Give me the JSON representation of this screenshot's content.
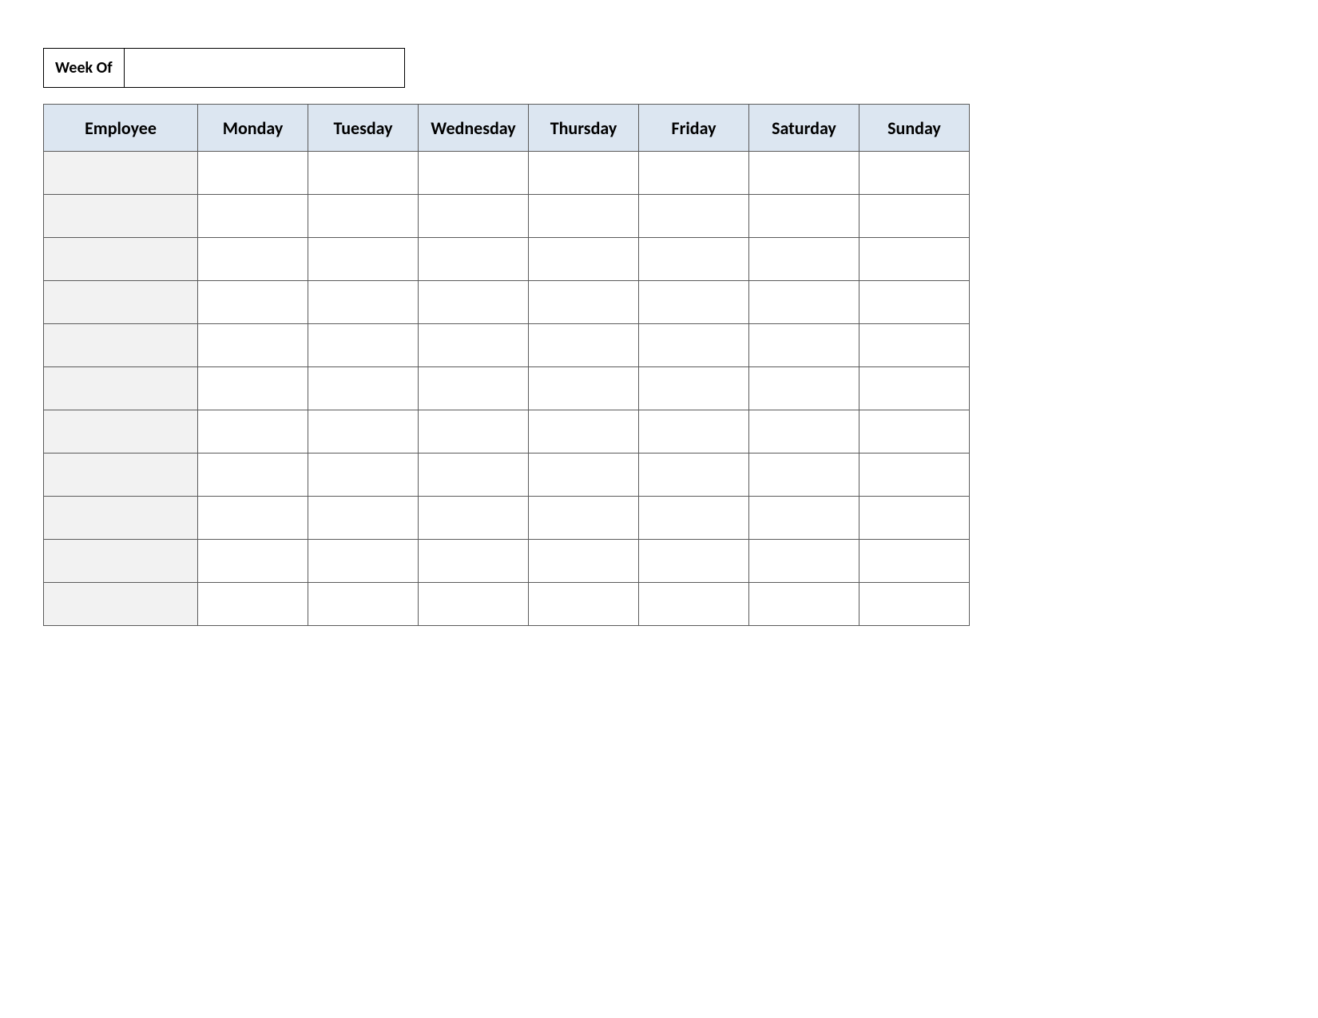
{
  "week_of": {
    "label": "Week Of",
    "value": ""
  },
  "headers": {
    "employee": "Employee",
    "days": [
      "Monday",
      "Tuesday",
      "Wednesday",
      "Thursday",
      "Friday",
      "Saturday",
      "Sunday"
    ]
  },
  "rows": [
    {
      "employee": "",
      "cells": [
        "",
        "",
        "",
        "",
        "",
        "",
        ""
      ]
    },
    {
      "employee": "",
      "cells": [
        "",
        "",
        "",
        "",
        "",
        "",
        ""
      ]
    },
    {
      "employee": "",
      "cells": [
        "",
        "",
        "",
        "",
        "",
        "",
        ""
      ]
    },
    {
      "employee": "",
      "cells": [
        "",
        "",
        "",
        "",
        "",
        "",
        ""
      ]
    },
    {
      "employee": "",
      "cells": [
        "",
        "",
        "",
        "",
        "",
        "",
        ""
      ]
    },
    {
      "employee": "",
      "cells": [
        "",
        "",
        "",
        "",
        "",
        "",
        ""
      ]
    },
    {
      "employee": "",
      "cells": [
        "",
        "",
        "",
        "",
        "",
        "",
        ""
      ]
    },
    {
      "employee": "",
      "cells": [
        "",
        "",
        "",
        "",
        "",
        "",
        ""
      ]
    },
    {
      "employee": "",
      "cells": [
        "",
        "",
        "",
        "",
        "",
        "",
        ""
      ]
    },
    {
      "employee": "",
      "cells": [
        "",
        "",
        "",
        "",
        "",
        "",
        ""
      ]
    },
    {
      "employee": "",
      "cells": [
        "",
        "",
        "",
        "",
        "",
        "",
        ""
      ]
    }
  ],
  "colors": {
    "header_bg": "#dce6f1",
    "employee_col_bg": "#f2f2f2",
    "border": "#5b5b5b"
  }
}
